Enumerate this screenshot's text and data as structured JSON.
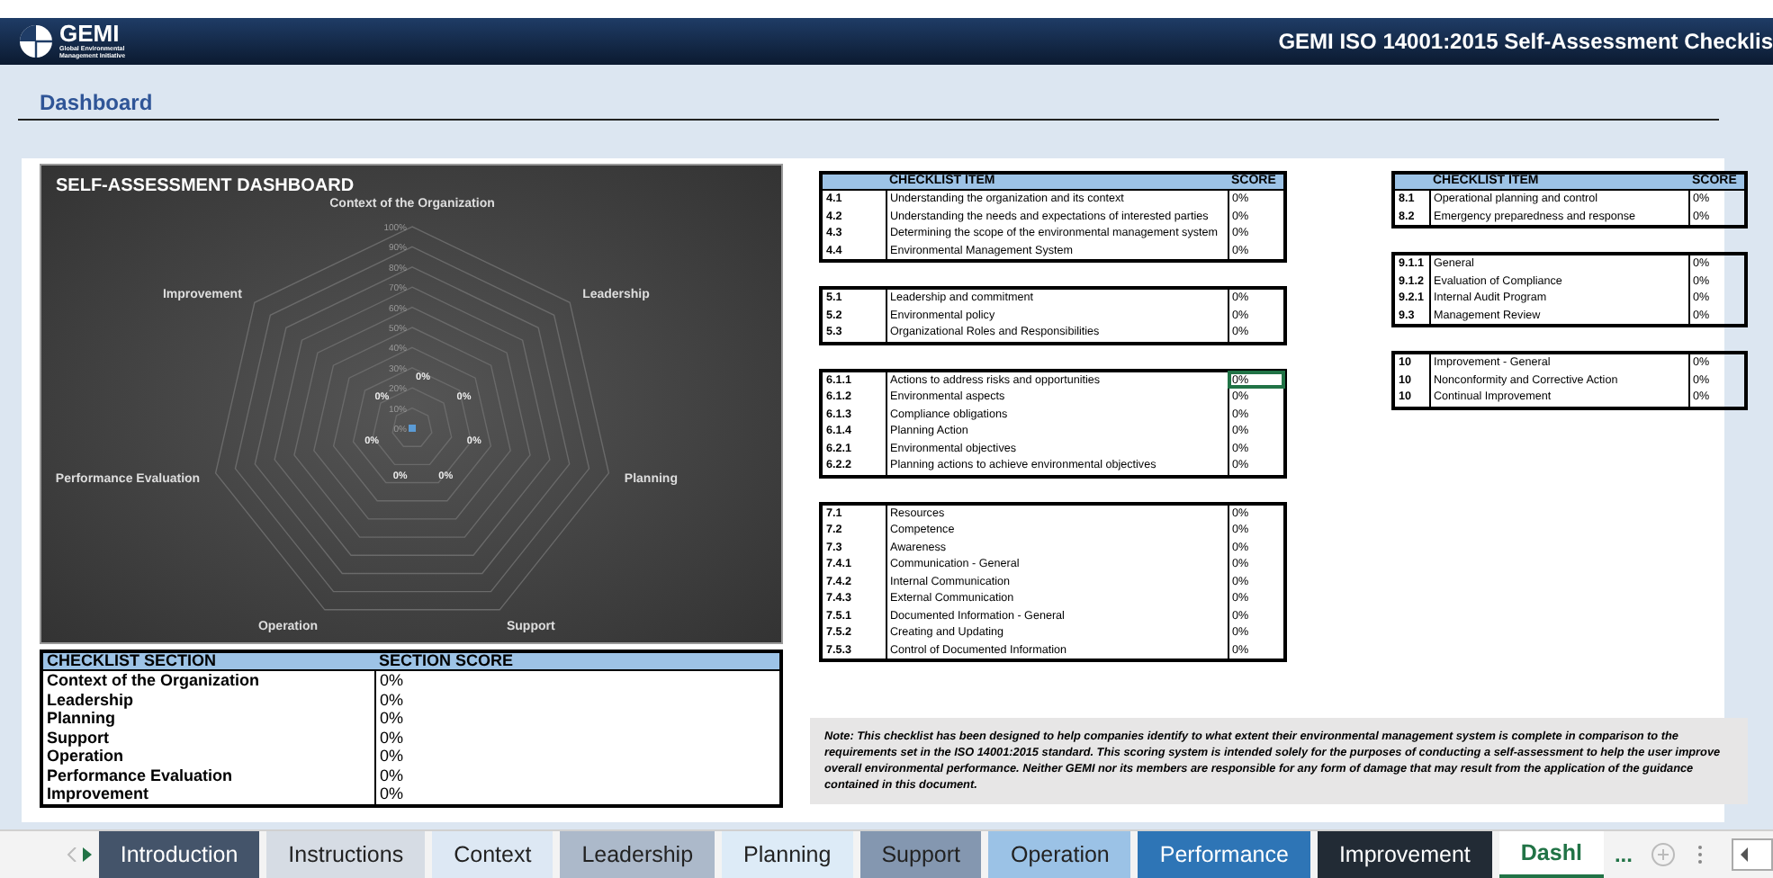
{
  "header": {
    "logo_text": "GEMI",
    "logo_lines": [
      "Global Environmental",
      "Management Initiative"
    ],
    "title": "GEMI ISO 14001:2015 Self-Assessment Checklis"
  },
  "sheet_title": "Dashboard",
  "dashboard": {
    "title": "SELF-ASSESSMENT DASHBOARD",
    "radar": {
      "axes": [
        "Context of the Organization",
        "Leadership",
        "Planning",
        "Support",
        "Operation",
        "Performance Evaluation",
        "Improvement"
      ],
      "rings": [
        "100%",
        "90%",
        "80%",
        "70%",
        "60%",
        "50%",
        "40%",
        "30%",
        "20%",
        "10%",
        "0%"
      ],
      "data_labels": [
        "0%",
        "0%",
        "0%",
        "0%",
        "0%",
        "0%",
        "0%"
      ]
    }
  },
  "section_table": {
    "columns": [
      "CHECKLIST SECTION",
      "SECTION SCORE"
    ],
    "rows": [
      [
        "Context of the Organization",
        "0%"
      ],
      [
        "Leadership",
        "0%"
      ],
      [
        "Planning",
        "0%"
      ],
      [
        "Support",
        "0%"
      ],
      [
        "Operation",
        "0%"
      ],
      [
        "Performance Evaluation",
        "0%"
      ],
      [
        "Improvement",
        "0%"
      ]
    ]
  },
  "checklists": [
    {
      "columns": [
        "CHECKLIST ITEM",
        "SCORE"
      ],
      "groups": [
        [
          {
            "num": "4.1",
            "text": "Understanding the organization and its context",
            "score": "0%",
            "selected": false
          },
          {
            "num": "4.2",
            "text": "Understanding the needs and expectations of interested parties",
            "score": "0%",
            "selected": false
          },
          {
            "num": "4.3",
            "text": "Determining the scope of the environmental management system",
            "score": "0%",
            "selected": false
          },
          {
            "num": "4.4",
            "text": "Environmental Management System",
            "score": "0%",
            "selected": false
          }
        ],
        [
          {
            "num": "5.1",
            "text": "Leadership and commitment",
            "score": "0%",
            "selected": false
          },
          {
            "num": "5.2",
            "text": "Environmental policy",
            "score": "0%",
            "selected": false
          },
          {
            "num": "5.3",
            "text": "Organizational Roles and Responsibilities",
            "score": "0%",
            "selected": false
          }
        ],
        [
          {
            "num": "6.1.1",
            "text": "Actions to address risks and opportunities",
            "score": "0%",
            "selected": true
          },
          {
            "num": "6.1.2",
            "text": "Environmental aspects",
            "score": "0%",
            "selected": false
          },
          {
            "num": "6.1.3",
            "text": "Compliance obligations",
            "score": "0%",
            "selected": false
          },
          {
            "num": "6.1.4",
            "text": "Planning Action",
            "score": "0%",
            "selected": false
          },
          {
            "num": "6.2.1",
            "text": "Environmental objectives",
            "score": "0%",
            "selected": false
          },
          {
            "num": "6.2.2",
            "text": "Planning actions to achieve environmental objectives",
            "score": "0%",
            "selected": false
          }
        ],
        [
          {
            "num": "7.1",
            "text": "Resources",
            "score": "0%",
            "selected": false
          },
          {
            "num": "7.2",
            "text": "Competence",
            "score": "0%",
            "selected": false
          },
          {
            "num": "7.3",
            "text": "Awareness",
            "score": "0%",
            "selected": false
          },
          {
            "num": "7.4.1",
            "text": "Communication - General",
            "score": "0%",
            "selected": false
          },
          {
            "num": "7.4.2",
            "text": "Internal Communication",
            "score": "0%",
            "selected": false
          },
          {
            "num": "7.4.3",
            "text": "External Communication",
            "score": "0%",
            "selected": false
          },
          {
            "num": "7.5.1",
            "text": "Documented Information - General",
            "score": "0%",
            "selected": false
          },
          {
            "num": "7.5.2",
            "text": "Creating and Updating",
            "score": "0%",
            "selected": false
          },
          {
            "num": "7.5.3",
            "text": "Control of Documented Information",
            "score": "0%",
            "selected": false
          }
        ]
      ]
    },
    {
      "columns": [
        "CHECKLIST ITEM",
        "SCORE"
      ],
      "groups": [
        [
          {
            "num": "8.1",
            "text": "Operational planning and control",
            "score": "0%",
            "selected": false
          },
          {
            "num": "8.2",
            "text": "Emergency preparedness and response",
            "score": "0%",
            "selected": false
          }
        ],
        [
          {
            "num": "9.1.1",
            "text": "General",
            "score": "0%",
            "selected": false
          },
          {
            "num": "9.1.2",
            "text": "Evaluation of Compliance",
            "score": "0%",
            "selected": false
          },
          {
            "num": "9.2.1",
            "text": "Internal Audit Program",
            "score": "0%",
            "selected": false
          },
          {
            "num": "9.3",
            "text": "Management Review",
            "score": "0%",
            "selected": false
          }
        ],
        [
          {
            "num": "10",
            "text": "Improvement - General",
            "score": "0%",
            "selected": false
          },
          {
            "num": "10",
            "text": "Nonconformity and Corrective Action",
            "score": "0%",
            "selected": false
          },
          {
            "num": "10",
            "text": "Continual Improvement",
            "score": "0%",
            "selected": false
          }
        ]
      ]
    }
  ],
  "note": "Note: This checklist has been designed to help companies identify to what extent their environmental management system is complete in comparison to the requirements set in the ISO 14001:2015 standard. This scoring system is intended solely for the purposes of conducting a self-assessment to help the user improve overall environmental performance. Neither GEMI nor its members are responsible for any form of damage that may result from the application of the guidance contained in this document.",
  "sheet_tabs": [
    {
      "label": "Introduction",
      "selected": false,
      "color": "#44546a"
    },
    {
      "label": "Instructions",
      "selected": false,
      "color": "#d6dce4"
    },
    {
      "label": "Context",
      "selected": false,
      "color": "#dde8f4"
    },
    {
      "label": "Leadership",
      "selected": false,
      "color": "#acb9ca"
    },
    {
      "label": "Planning",
      "selected": false,
      "color": "#ddebf7"
    },
    {
      "label": "Support",
      "selected": false,
      "color": "#8497b0"
    },
    {
      "label": "Operation",
      "selected": false,
      "color": "#9bc2e6"
    },
    {
      "label": "Performance",
      "selected": false,
      "color": "#2e75b6"
    },
    {
      "label": "Improvement",
      "selected": false,
      "color": "#222b35"
    },
    {
      "label": "Dashl",
      "selected": true,
      "color": "#ffffff"
    }
  ],
  "more_tabs": "..."
}
